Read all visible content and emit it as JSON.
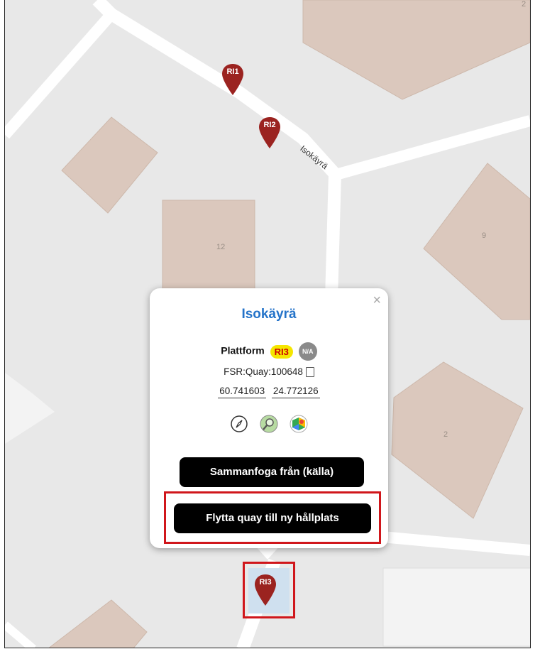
{
  "map": {
    "markers": [
      {
        "label": "RI1",
        "color": "#9b2320"
      },
      {
        "label": "RI2",
        "color": "#9b2320"
      },
      {
        "label": "RI3",
        "color": "#9b2320"
      }
    ],
    "building_numbers": {
      "b12": "12",
      "b9": "9",
      "b2": "2",
      "corner": "2"
    },
    "street_name": "Isokäyrä",
    "colors": {
      "background": "#e8e8e8",
      "building": "#dbc8bd",
      "road": "#ffffff",
      "highlight": "#d0161b"
    }
  },
  "popup": {
    "title": "Isokäyrä",
    "close_symbol": "×",
    "type_label": "Plattform",
    "code_badge": "RI3",
    "na_badge": "N/A",
    "id_text": "FSR:Quay:100648",
    "latitude": "60.741603",
    "longitude": "24.772126",
    "icons": [
      "compass-icon",
      "magnifier-map-icon",
      "google-maps-icon"
    ],
    "merge_button": "Sammanfoga från (källa)",
    "move_button": "Flytta quay till ny hållplats"
  }
}
